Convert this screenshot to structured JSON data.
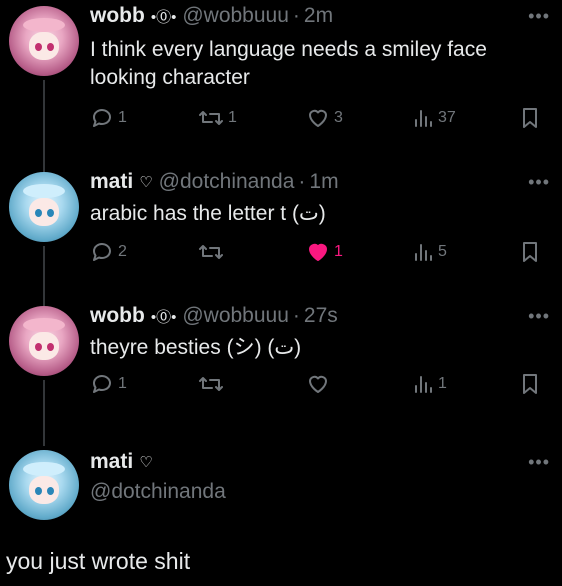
{
  "tweets": [
    {
      "name": "wobb",
      "badge": "•⓪•",
      "handle": "@wobbuuu",
      "sep": "·",
      "time": "2m",
      "text": "I think every language needs a smiley face looking character",
      "more": "•••",
      "replies": "1",
      "retweets": "1",
      "likes": "3",
      "views": "37"
    },
    {
      "name": "mati",
      "badge": "♡",
      "handle": "@dotchinanda",
      "sep": "·",
      "time": "1m",
      "text": "arabic has the letter t (ت)",
      "more": "•••",
      "replies": "2",
      "retweets": "",
      "likes": "1",
      "views": "5"
    },
    {
      "name": "wobb",
      "badge": "•⓪•",
      "handle": "@wobbuuu",
      "sep": "·",
      "time": "27s",
      "text": "theyre besties (シ) (ت)",
      "more": "•••",
      "replies": "1",
      "retweets": "",
      "likes": "",
      "views": "1"
    }
  ],
  "compose": {
    "name": "mati",
    "badge": "♡",
    "handle": "@dotchinanda",
    "more": "•••",
    "reply_text": "you just wrote shit"
  },
  "colors": {
    "background": "#000000",
    "text": "#e7e9ea",
    "muted": "#71767b",
    "like": "#f91880"
  },
  "icons": [
    "reply-icon",
    "retweet-icon",
    "heart-icon",
    "views-icon",
    "bookmark-icon",
    "more-icon"
  ]
}
